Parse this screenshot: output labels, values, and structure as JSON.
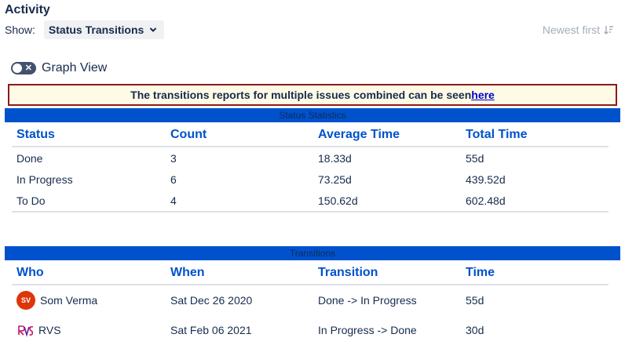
{
  "header": {
    "title": "Activity",
    "show_label": "Show:",
    "show_value": "Status Transitions",
    "sort_label": "Newest first"
  },
  "graph_view": {
    "label": "Graph View",
    "enabled": false
  },
  "notice": {
    "text": "The transitions reports for multiple issues combined can be seen",
    "link": " here"
  },
  "status_statistics": {
    "title": "Status Statistics",
    "columns": [
      "Status",
      "Count",
      "Average Time",
      "Total Time"
    ],
    "rows": [
      [
        "Done",
        "3",
        "18.33d",
        "55d"
      ],
      [
        "In Progress",
        "6",
        "73.25d",
        "439.52d"
      ],
      [
        "To Do",
        "4",
        "150.62d",
        "602.48d"
      ]
    ]
  },
  "transitions": {
    "title": "Transitions",
    "columns": [
      "Who",
      "When",
      "Transition",
      "Time"
    ],
    "rows": [
      {
        "initials": "SV",
        "who": "Som Verma",
        "when": "Sat Dec 26 2020",
        "transition": "Done -> In Progress",
        "time": "55d"
      },
      {
        "initials": "",
        "who": "RVS",
        "when": "Sat Feb 06 2021",
        "transition": "In Progress -> Done",
        "time": "30d"
      }
    ]
  },
  "colors": {
    "accent": "#0052cc",
    "notice_border": "#8b1a1a",
    "notice_bg": "#fffae6",
    "avatar": "#de350b"
  }
}
